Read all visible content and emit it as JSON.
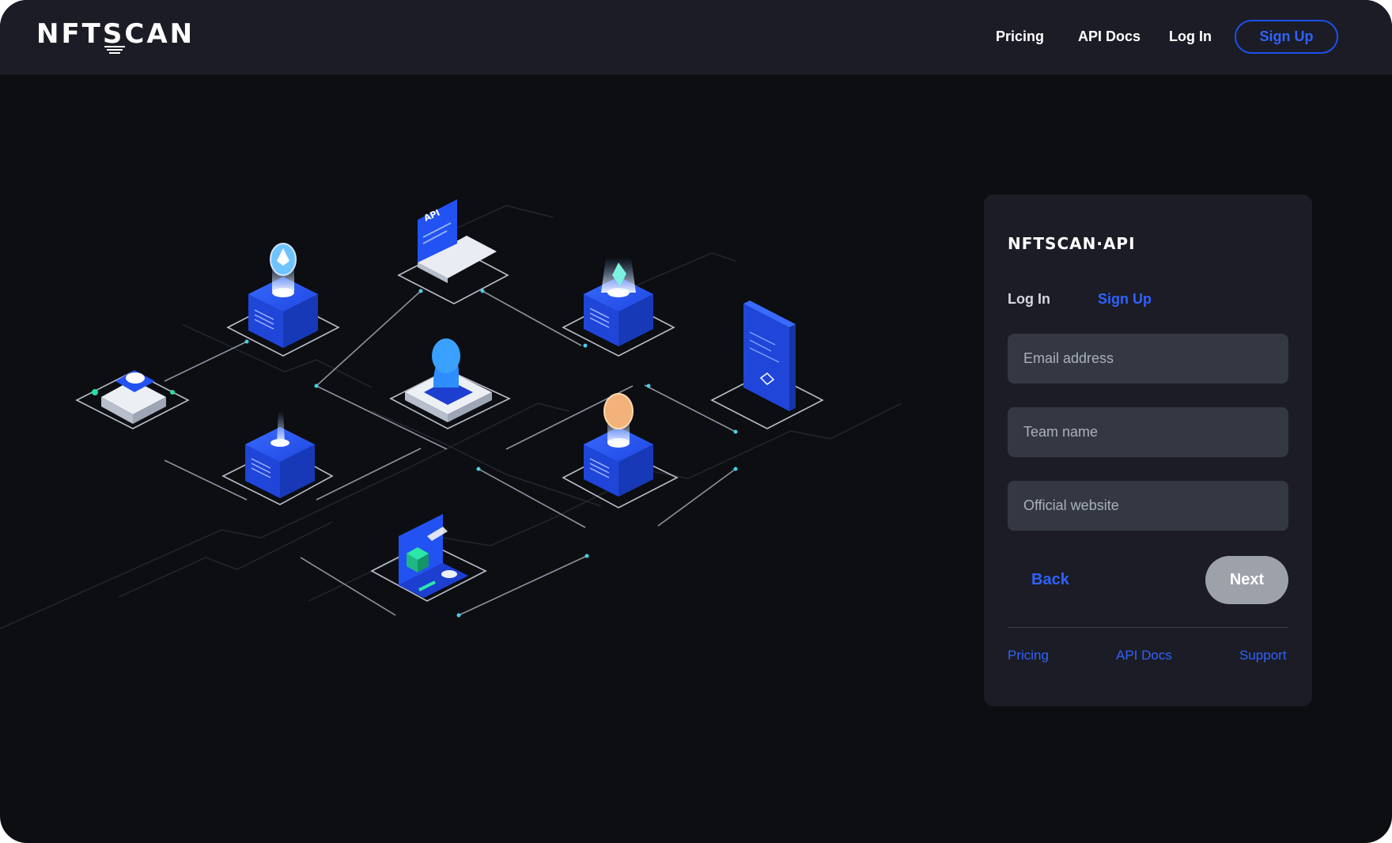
{
  "header": {
    "logo": "NFTSCAN",
    "nav": {
      "pricing": "Pricing",
      "api_docs": "API Docs",
      "login": "Log In",
      "signup": "Sign Up"
    }
  },
  "card": {
    "logo": "NFTSCAN·API",
    "tabs": {
      "login": "Log In",
      "signup": "Sign Up"
    },
    "fields": {
      "email_placeholder": "Email address",
      "team_placeholder": "Team name",
      "website_placeholder": "Official website"
    },
    "back_label": "Back",
    "next_label": "Next",
    "footer": {
      "pricing": "Pricing",
      "api_docs": "API Docs",
      "support": "Support"
    }
  },
  "illustration": {
    "nodes": [
      "api-laptop-icon",
      "ethereum-server-icon",
      "crystal-server-icon",
      "chip-icon",
      "cloud-icon",
      "data-server-icon",
      "document-icon",
      "bitcoin-server-icon",
      "nft-card-icon"
    ],
    "laptop_text": "API"
  },
  "colors": {
    "accent": "#2f62ff",
    "background": "#0c0e12",
    "card": "#1b1c25",
    "field": "#343843"
  }
}
